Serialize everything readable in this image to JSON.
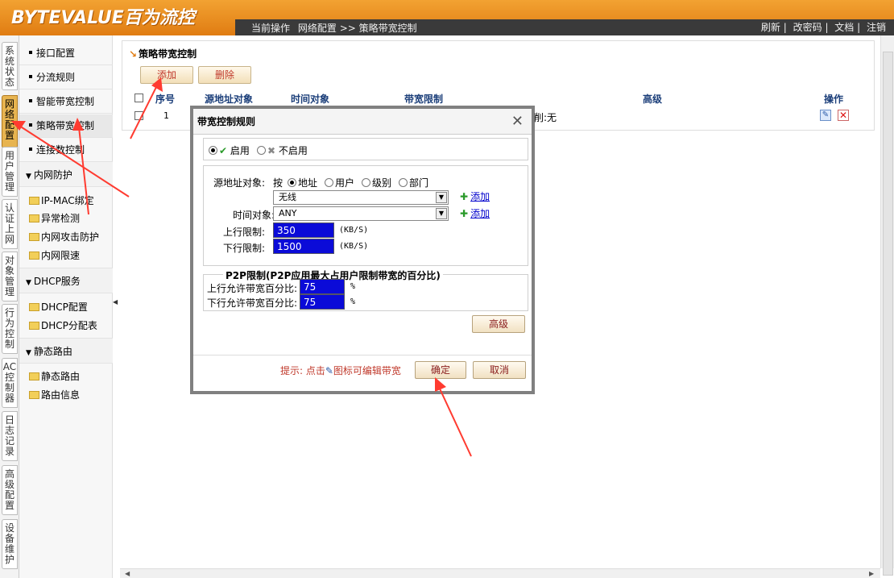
{
  "brand": {
    "logo_text": "BYTEVALUE百为流控"
  },
  "header": {
    "path_label": "当前操作",
    "path_section": "网络配置",
    "path_sep": ">>",
    "path_page": "策略带宽控制",
    "links": [
      "刷新",
      "改密码",
      "文档",
      "注销"
    ]
  },
  "vtabs": [
    "系统状态",
    "网络配置",
    "用户管理",
    "认证上网",
    "对象管理",
    "行为控制",
    "AC控制器",
    "日志记录",
    "高级配置",
    "设备维护"
  ],
  "nav": {
    "items": [
      "接口配置",
      "分流规则",
      "智能带宽控制",
      "策略带宽控制",
      "连接数控制"
    ],
    "group_lan": "内网防护",
    "lan_items": [
      "IP-MAC绑定",
      "异常检测",
      "内网攻击防护",
      "内网限速"
    ],
    "group_dhcp": "DHCP服务",
    "dhcp_items": [
      "DHCP配置",
      "DHCP分配表"
    ],
    "group_route": "静态路由",
    "route_items": [
      "静态路由",
      "路由信息"
    ]
  },
  "panel": {
    "title": "策略带宽控制",
    "add_label": "添加",
    "delete_label": "删除",
    "columns": [
      "序号",
      "源地址对象",
      "时间对象",
      "带宽限制",
      "高级",
      "操作"
    ],
    "rows": [
      {
        "index": "1",
        "partial_text": "削:无"
      }
    ]
  },
  "dialog": {
    "title": "带宽控制规则",
    "enable_label": "启用",
    "disable_label": "不启用",
    "src_label": "源地址对象:",
    "by_label": "按",
    "by_options": [
      "地址",
      "用户",
      "级别",
      "部门"
    ],
    "src_value": "无线",
    "time_label": "时间对象:",
    "time_value": "ANY",
    "add_link": "添加",
    "up_label": "上行限制:",
    "up_value": "350",
    "down_label": "下行限制:",
    "down_value": "1500",
    "rate_unit": "(KB/S)",
    "p2p_legend": "P2P限制(P2P应用最大占用户限制带宽的百分比)",
    "p2p_up_label": "上行允许带宽百分比:",
    "p2p_up_value": "75",
    "p2p_down_label": "下行允许带宽百分比:",
    "p2p_down_value": "75",
    "percent_unit": "%",
    "advanced_label": "高级",
    "hint_prefix": "提示: 点击",
    "hint_suffix": "图标可编辑带宽",
    "ok_label": "确定",
    "cancel_label": "取消"
  },
  "colors": {
    "header_orange": "#e88a1a",
    "input_blue": "#0b0bd8",
    "annotation_red": "#ff3b30"
  }
}
